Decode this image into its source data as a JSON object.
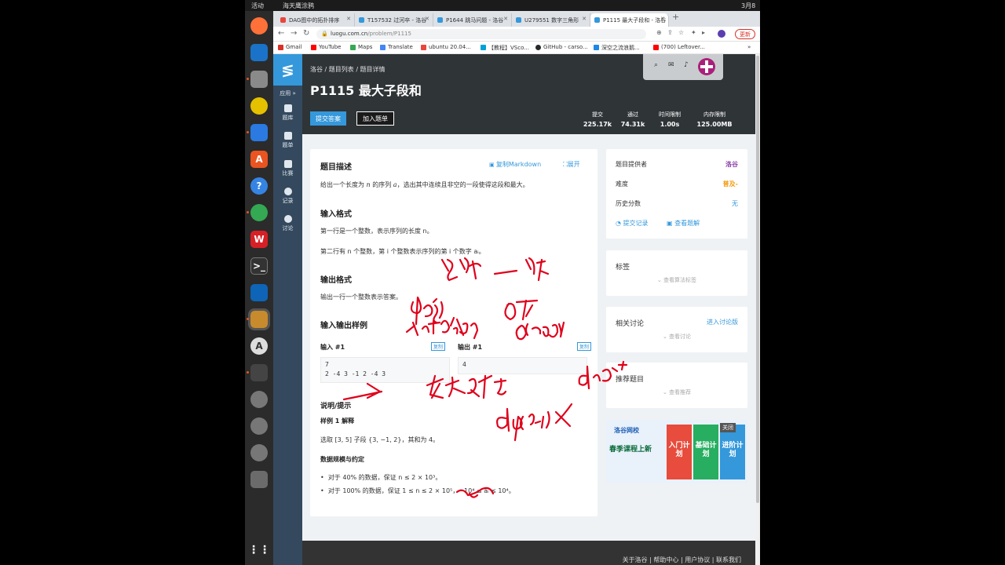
{
  "topbar": {
    "activities": "活动",
    "app": "海天鹰涂鸦",
    "date": "3月8日"
  },
  "tabs": [
    {
      "label": "DAG图中的拓扑排序",
      "color": "#e8453c"
    },
    {
      "label": "T157532 过河卒 - 洛谷",
      "color": "#3498db"
    },
    {
      "label": "P1644 跳马问题 - 洛谷",
      "color": "#3498db"
    },
    {
      "label": "U279551 数字三角形",
      "color": "#3498db"
    },
    {
      "label": "P1115 最大子段和 - 洛谷",
      "color": "#3498db"
    }
  ],
  "addressbar": {
    "domain": "luogu.com.cn",
    "path": "/problem/P1115",
    "update_label": "更新"
  },
  "bookmarks": [
    {
      "label": "Gmail",
      "color": "#d93025"
    },
    {
      "label": "YouTube",
      "color": "#ff0000"
    },
    {
      "label": "Maps",
      "color": "#34a853"
    },
    {
      "label": "Translate",
      "color": "#4285f4"
    },
    {
      "label": "ubuntu 20.04...",
      "color": "#e8453c"
    },
    {
      "label": "【教程】VSco...",
      "color": "#00a1d6"
    },
    {
      "label": "GitHub - carso...",
      "color": "#24292e"
    },
    {
      "label": "深空之流浪鹅...",
      "color": "#1e88e5"
    },
    {
      "label": "(700) Leftover...",
      "color": "#ff0000"
    }
  ],
  "sidebar": {
    "apps_label": "应用 »",
    "items": [
      {
        "label": "题库"
      },
      {
        "label": "题单"
      },
      {
        "label": "比赛"
      },
      {
        "label": "记录"
      },
      {
        "label": "讨论"
      }
    ]
  },
  "header": {
    "breadcrumb": "洛谷 / 题目列表 / 题目详情",
    "title": "P1115 最大子段和",
    "submit_label": "提交答案",
    "add_list_label": "加入题单",
    "stats": [
      {
        "label": "提交",
        "value": "225.17k"
      },
      {
        "label": "通过",
        "value": "74.31k"
      },
      {
        "label": "时间限制",
        "value": "1.00s"
      },
      {
        "label": "内存限制",
        "value": "125.00MB"
      }
    ]
  },
  "problem": {
    "desc_title": "题目描述",
    "copy_markdown": "复制Markdown",
    "expand": "展开",
    "desc_text_a": "给出一个长度为",
    "desc_var": "n",
    "desc_text_b": "的序列",
    "desc_var2": "a",
    "desc_text_c": "，选出其中连续且非空的一段使得这段和最大。",
    "input_title": "输入格式",
    "input_line1": "第一行是一个整数，表示序列的长度 n。",
    "input_line2": "第二行有 n 个整数，第 i 个整数表示序列的第 i 个数字 aᵢ。",
    "output_title": "输出格式",
    "output_line": "输出一行一个整数表示答案。",
    "samples_title": "输入输出样例",
    "input_sample_label": "输入 #1",
    "output_sample_label": "输出 #1",
    "copy_tag": "复制",
    "input_sample_l1": "7",
    "input_sample_l2": "2 -4 3 -1 2 -4 3",
    "output_sample": "4",
    "hint_title": "说明/提示",
    "sample_explain_title": "样例 1 解释",
    "sample_explain": "选取 [3, 5] 子段 {3, −1, 2}，其和为 4。",
    "range_title": "数据规模与约定",
    "range_1": "对于 40% 的数据，保证 n ≤ 2 × 10³。",
    "range_2": "对于 100% 的数据，保证 1 ≤ n ≤ 2 × 10⁵，−10⁴ ≤ aᵢ ≤ 10⁴。"
  },
  "info": {
    "provider_label": "题目提供者",
    "provider_value": "洛谷",
    "difficulty_label": "难度",
    "difficulty_value": "普及-",
    "history_label": "历史分数",
    "history_value": "无",
    "submissions_link": "提交记录",
    "solutions_link": "查看题解"
  },
  "tags": {
    "title": "标签",
    "sub": "查看算法标签"
  },
  "discuss": {
    "title": "相关讨论",
    "link": "进入讨论版",
    "sub": "查看讨论"
  },
  "recommend": {
    "title": "推荐题目",
    "sub": "查看推荐"
  },
  "ad": {
    "brand": "洛谷网校",
    "slogan": "春季课程上新",
    "close": "关闭",
    "blocks": [
      {
        "label": "入门计划",
        "color": "#e74c3c"
      },
      {
        "label": "基础计划",
        "color": "#27ae60"
      },
      {
        "label": "进阶计划",
        "color": "#3498db"
      }
    ]
  },
  "footer": {
    "links": "关于洛谷 | 帮助中心 | 用户协议 | 联系我们"
  },
  "colors": {
    "accent": "#3498db",
    "header_bg": "#2f3437",
    "sidebar_bg": "#34495e",
    "ink": "#e0001b",
    "provider": "#8e44ad",
    "difficulty": "#f39c11"
  }
}
